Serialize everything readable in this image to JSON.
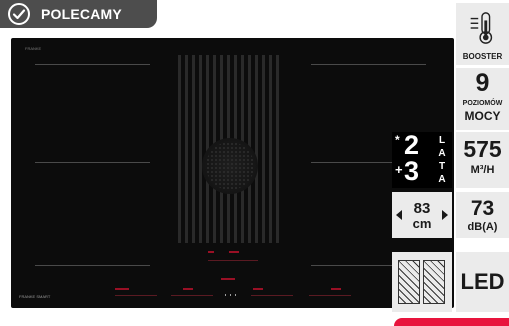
{
  "badge": {
    "label": "POLECAMY",
    "icon": "check-circle-icon"
  },
  "hob": {
    "brand_top": "FRANKE",
    "brand_bottom": "FRANKE SMART"
  },
  "features": {
    "booster": {
      "label": "BOOSTER",
      "icon": "thermometer-icon"
    },
    "power_levels": {
      "number": "9",
      "line1": "POZIOMÓW",
      "line2": "MOCY"
    },
    "warranty": {
      "star": "*",
      "base_years": "2",
      "plus": "+",
      "extra_years": "3",
      "letters": [
        "L",
        "A",
        "T",
        "A"
      ]
    },
    "airflow": {
      "value": "575",
      "unit": "M³/H"
    },
    "width": {
      "value": "83",
      "unit": "cm"
    },
    "noise": {
      "value": "73",
      "unit": "dB(A)"
    },
    "cooking_zones": {
      "icon": "cooking-zones-icon"
    },
    "lighting": {
      "label": "LED"
    }
  }
}
